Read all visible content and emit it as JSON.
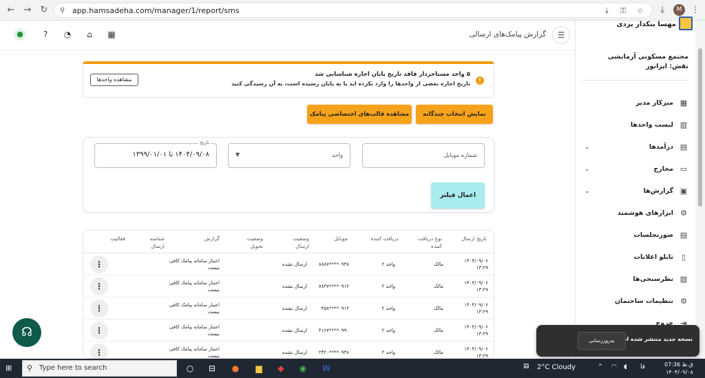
{
  "browser": {
    "url": "app.hamsadeha.com/manager/1/report/sms",
    "profile_initial": "M"
  },
  "topbar": {
    "title": "گزارش پیامک‌های ارسالی"
  },
  "sidebar": {
    "user_name": "مهسا بنکدار یزدی",
    "org_line1": "مجتمع مسکونی آزمایشی",
    "org_line2": "نقش: اپراتور",
    "items": [
      {
        "label": "میزکار مدیر",
        "icon": "▦",
        "chev": ""
      },
      {
        "label": "لیست واحدها",
        "icon": "▥",
        "chev": ""
      },
      {
        "label": "درآمدها",
        "icon": "▤",
        "chev": "⌄"
      },
      {
        "label": "مخارج",
        "icon": "▭",
        "chev": "⌄"
      },
      {
        "label": "گزارش‌ها",
        "icon": "▣",
        "chev": "⌄"
      },
      {
        "label": "ابزارهای هوشمند",
        "icon": "⚙",
        "chev": ""
      },
      {
        "label": "صورتجلسات",
        "icon": "▤",
        "chev": ""
      },
      {
        "label": "تابلو اعلانات",
        "icon": "▯",
        "chev": ""
      },
      {
        "label": "نظرسنجی‌ها",
        "icon": "▨",
        "chev": ""
      },
      {
        "label": "تنظیمات ساختمان",
        "icon": "⚙",
        "chev": ""
      },
      {
        "label": "خروج",
        "icon": "⇥",
        "chev": ""
      }
    ]
  },
  "alert": {
    "line1": "۵ واحد مستاجردار فاقد تاریخ پایان اجاره شناسایی شد",
    "line2": "تاریخ اجاره بعضی از واحدها را وارد نکرده اید یا به پایان رسیده است، به آن رسیدگی کنید",
    "button": "مشاهده واحدها"
  },
  "actions": {
    "multi_select": "نمایش انتخاب چندگانه",
    "templates": "مشاهده قالب‌های اختصاصی پیامک"
  },
  "filter": {
    "mobile_placeholder": "شماره موبایل",
    "unit_placeholder": "واحد",
    "date_legend": "تاریخ",
    "date_value": "۱۴۰۴/۰۹/۰۸ تا ۱۳۹۹/۰۱/۰۱",
    "apply": "اعمال فیلتر"
  },
  "table": {
    "headers": {
      "date": "تاریخ ارسال",
      "recipient_type": "نوع دریافت کننده",
      "recipient": "دریافت کننده",
      "mobile": "موبایل",
      "send_status": "وضعیت ارسال",
      "delivery_status": "وضعیت تحویل",
      "report": "گزارش",
      "send_id": "شناسه ارسال",
      "activity": "فعالیت"
    },
    "rows": [
      {
        "date": "۱۴۰۴/۰۹/۰۶ ۱۳:۲۹",
        "recipient_type": "مالک",
        "recipient": "واحد ۲",
        "mobile": "۰۹۳۸****۸۸۸۷",
        "send_status": "ارسال نشده",
        "report": "اعتبار سامانه پیامک کافی نیست"
      },
      {
        "date": "۱۴۰۴/۰۹/۰۶ ۱۳:۲۹",
        "recipient_type": "مالک",
        "recipient": "واحد ۲",
        "mobile": "۰۹۱۲****۷۸۳۷",
        "send_status": "ارسال نشده",
        "report": "اعتبار سامانه پیامک کافی نیست"
      },
      {
        "date": "۱۴۰۴/۰۹/۰۶ ۱۳:۲۹",
        "recipient_type": "مالک",
        "recipient": "واحد ۲",
        "mobile": "۰۹۱۲****۴۵۸",
        "send_status": "ارسال نشده",
        "report": "اعتبار سامانه پیامک کافی نیست"
      },
      {
        "date": "۱۴۰۴/۰۹/۰۶ ۱۳:۲۹",
        "recipient_type": "مالک",
        "recipient": "واحد ۲",
        "mobile": "۰۹۹۰****۴۱۶۷",
        "send_status": "ارسال نشده",
        "report": "اعتبار سامانه پیامک کافی نیست"
      },
      {
        "date": "۱۴۰۴/۰۹/۰۶ ۱۳:۲۹",
        "recipient_type": "مالک",
        "recipient": "واحد ۲",
        "mobile": "۰۹۳۸****۲۴۲۰",
        "send_status": "ارسال نشده",
        "report": "اعتبار سامانه پیامک کافی نیست"
      }
    ]
  },
  "toast": {
    "message": "نسخه جدید منتشر شده است.",
    "button": "به‌روزرسانی"
  },
  "taskbar": {
    "search": "Type here to search",
    "weather": "2°C  Cloudy",
    "lang": "فا",
    "time": "ق.ظ 07:36",
    "date": "۱۴۰۴/۰۹/۰۸"
  }
}
